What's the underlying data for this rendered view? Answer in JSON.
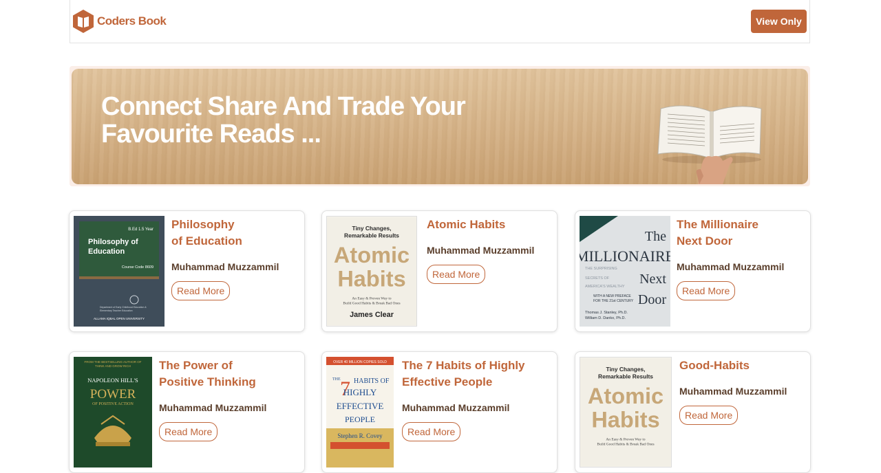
{
  "header": {
    "brand": "Coders Book",
    "view_button": "View Only",
    "logo_icon": "open-book-icon",
    "accent_color": "#c0663a"
  },
  "hero": {
    "line1": "Connect Share And Trade Your",
    "line2": "Favourite Reads ..."
  },
  "books": [
    {
      "title": "Philosophy of Education",
      "author": "Muhammad Muzzammil",
      "button": "Read More",
      "cover": {
        "top_right": "B.Ed 1.5 Year",
        "title_line1": "Philosophy of",
        "title_line2": "Education",
        "code": "Course Code 8609",
        "dept1": "Department of Early Childhood Education &",
        "dept2": "Elementary Teacher Education",
        "footer": "ALLAMA IQBAL OPEN UNIVERSITY"
      }
    },
    {
      "title": "Atomic Habits",
      "author": "Muhammad Muzzammil",
      "button": "Read More",
      "cover": {
        "tagline1": "Tiny Changes,",
        "tagline2": "Remarkable Results",
        "word1": "Atomic",
        "word2": "Habits",
        "sub1": "An Easy & Proven Way to",
        "sub2": "Build Good Habits & Break Bad Ones",
        "author": "James Clear"
      }
    },
    {
      "title": "The Millionaire Next Door",
      "author": "Muhammad Muzzammil",
      "button": "Read More",
      "cover": {
        "the": "The",
        "word1": "MILLIONAIRE",
        "next": "Next",
        "door": "Door",
        "line1": "THE SURPRISING",
        "line2": "SECRETS OF",
        "line3": "AMERICA'S WEALTHY",
        "preface1": "WITH A NEW PREFACE",
        "preface2": "FOR THE 21st CENTURY",
        "auth1": "Thomas J. Stanley, Ph.D.",
        "auth2": "William D. Danko, Ph.D."
      }
    },
    {
      "title": "The Power of Positive Thinking",
      "author": "Muhammad Muzzammil",
      "button": "Read More",
      "cover": {
        "top1": "FROM THE BESTSELLING AUTHOR OF",
        "top2": "THINK AND GROW RICH",
        "name": "NAPOLEON HILL'S",
        "word": "POWER",
        "sub": "OF POSITIVE ACTION"
      }
    },
    {
      "title": "The 7 Habits of Highly Effective People",
      "author": "Muhammad Muzzammil",
      "button": "Read More",
      "cover": {
        "banner": "OVER 40 MILLION COPIES SOLD",
        "the": "THE",
        "seven": "7",
        "l1": "HABITS OF",
        "l2": "HIGHLY",
        "l3": "EFFECTIVE",
        "l4": "PEOPLE",
        "author": "Stephen R. Covey"
      }
    },
    {
      "title": "Good-Habits",
      "author": "Muhammad Muzzammil",
      "button": "Read More",
      "cover": {
        "tagline1": "Tiny Changes,",
        "tagline2": "Remarkable Results",
        "word1": "Atomic",
        "word2": "Habits",
        "sub1": "An Easy & Proven Way to",
        "sub2": "Build Good Habits & Break Bad Ones"
      }
    }
  ]
}
